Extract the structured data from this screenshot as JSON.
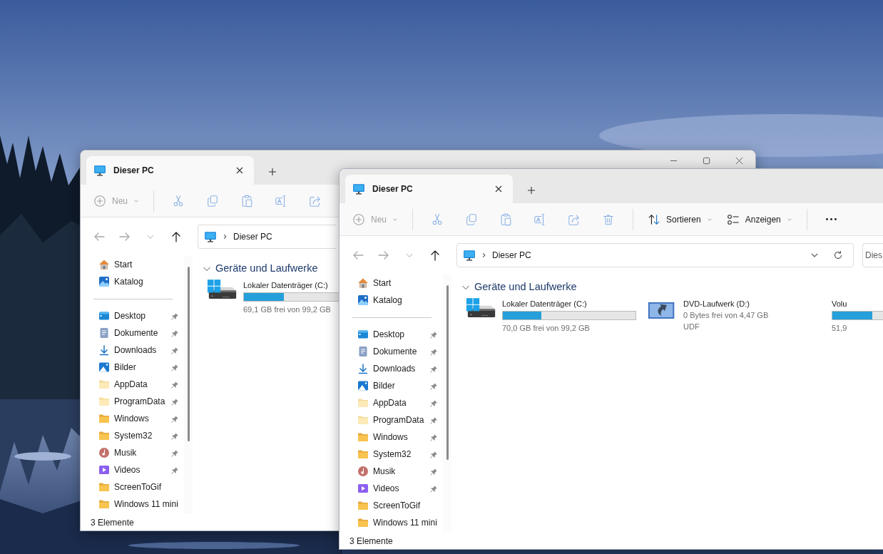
{
  "windows": [
    {
      "tabs": [
        {
          "label": "Dieser PC",
          "selected": true
        }
      ],
      "caption_buttons": [
        {
          "kind": "minimize"
        },
        {
          "kind": "maximize"
        },
        {
          "kind": "close"
        }
      ],
      "toolbar": [
        {
          "kind": "new",
          "label": "Neu",
          "disabled": true
        },
        {
          "kind": "cut",
          "disabled": true
        },
        {
          "kind": "copy",
          "disabled": true
        },
        {
          "kind": "paste",
          "disabled": true
        },
        {
          "kind": "rename",
          "disabled": true
        },
        {
          "kind": "share",
          "disabled": true
        }
      ],
      "navigation": [
        {
          "kind": "back",
          "disabled": true
        },
        {
          "kind": "forward",
          "disabled": true
        },
        {
          "kind": "recent",
          "disabled": true
        },
        {
          "kind": "up",
          "disabled": false
        }
      ],
      "address": {
        "path": "Dieser PC"
      },
      "sidebar": {
        "groups": [
          {
            "items": [
              {
                "kind": "home",
                "label": "Start",
                "pinned": false
              },
              {
                "kind": "gallery",
                "label": "Katalog",
                "pinned": false
              }
            ]
          },
          {
            "items": [
              {
                "kind": "desktop",
                "label": "Desktop",
                "pinned": true
              },
              {
                "kind": "documents",
                "label": "Dokumente",
                "pinned": true
              },
              {
                "kind": "downloads",
                "label": "Downloads",
                "pinned": true
              },
              {
                "kind": "pictures",
                "label": "Bilder",
                "pinned": true
              },
              {
                "kind": "folder-light",
                "label": "AppData",
                "pinned": true
              },
              {
                "kind": "folder-light",
                "label": "ProgramData",
                "pinned": true
              },
              {
                "kind": "folder",
                "label": "Windows",
                "pinned": true
              },
              {
                "kind": "folder",
                "label": "System32",
                "pinned": true
              },
              {
                "kind": "music",
                "label": "Musik",
                "pinned": true
              },
              {
                "kind": "videos",
                "label": "Videos",
                "pinned": true
              },
              {
                "kind": "folder",
                "label": "ScreenToGif",
                "pinned": false
              },
              {
                "kind": "folder",
                "label": "Windows 11 mini",
                "pinned": false
              }
            ]
          }
        ]
      },
      "section": {
        "title": "Geräte und Laufwerke",
        "expanded": true
      },
      "drives": [
        {
          "kind": "system",
          "name": "Lokaler Datenträger (C:)",
          "level": 0.3,
          "details": [
            "69,1 GB frei von 99,2 GB"
          ]
        }
      ],
      "status_bar": "3 Elemente"
    },
    {
      "tabs": [
        {
          "label": "Dieser PC",
          "selected": true
        }
      ],
      "toolbar": [
        {
          "kind": "new",
          "label": "Neu",
          "disabled": true
        },
        {
          "kind": "cut",
          "disabled": true
        },
        {
          "kind": "copy",
          "disabled": true
        },
        {
          "kind": "paste",
          "disabled": true
        },
        {
          "kind": "rename",
          "disabled": true
        },
        {
          "kind": "share",
          "disabled": true
        },
        {
          "kind": "delete",
          "disabled": true
        },
        {
          "kind": "sort",
          "label": "Sortieren",
          "disabled": false
        },
        {
          "kind": "view",
          "label": "Anzeigen",
          "disabled": false
        },
        {
          "kind": "more",
          "disabled": false
        }
      ],
      "navigation": [
        {
          "kind": "back",
          "disabled": true
        },
        {
          "kind": "forward",
          "disabled": true
        },
        {
          "kind": "recent",
          "disabled": true
        },
        {
          "kind": "up",
          "disabled": false
        }
      ],
      "address": {
        "path": "Dieser PC",
        "buttons": [
          {
            "kind": "dropdown"
          },
          {
            "kind": "refresh"
          }
        ]
      },
      "search": {
        "placeholder": "Dies"
      },
      "sidebar": {
        "groups": [
          {
            "items": [
              {
                "kind": "home",
                "label": "Start",
                "pinned": false
              },
              {
                "kind": "gallery",
                "label": "Katalog",
                "pinned": false
              }
            ]
          },
          {
            "items": [
              {
                "kind": "desktop",
                "label": "Desktop",
                "pinned": true
              },
              {
                "kind": "documents",
                "label": "Dokumente",
                "pinned": true
              },
              {
                "kind": "downloads",
                "label": "Downloads",
                "pinned": true
              },
              {
                "kind": "pictures",
                "label": "Bilder",
                "pinned": true
              },
              {
                "kind": "folder-light",
                "label": "AppData",
                "pinned": true
              },
              {
                "kind": "folder-light",
                "label": "ProgramData",
                "pinned": true
              },
              {
                "kind": "folder",
                "label": "Windows",
                "pinned": true
              },
              {
                "kind": "folder",
                "label": "System32",
                "pinned": true
              },
              {
                "kind": "music",
                "label": "Musik",
                "pinned": true
              },
              {
                "kind": "videos",
                "label": "Videos",
                "pinned": true
              },
              {
                "kind": "folder",
                "label": "ScreenToGif",
                "pinned": false
              },
              {
                "kind": "folder",
                "label": "Windows 11 mini",
                "pinned": false
              }
            ]
          }
        ]
      },
      "section": {
        "title": "Geräte und Laufwerke",
        "expanded": true
      },
      "drives": [
        {
          "kind": "system",
          "name": "Lokaler Datenträger (C:)",
          "level": 0.29,
          "details": [
            "70,0 GB frei von 99,2 GB"
          ]
        },
        {
          "kind": "dvd",
          "name": "DVD-Laufwerk (D:)",
          "details": [
            "0 Bytes frei von 4,47 GB",
            "UDF"
          ]
        },
        {
          "kind": "hdd",
          "name": "Volu",
          "level": 0.3,
          "details": [
            "51,9"
          ]
        }
      ],
      "status_bar": "3 Elemente"
    }
  ]
}
